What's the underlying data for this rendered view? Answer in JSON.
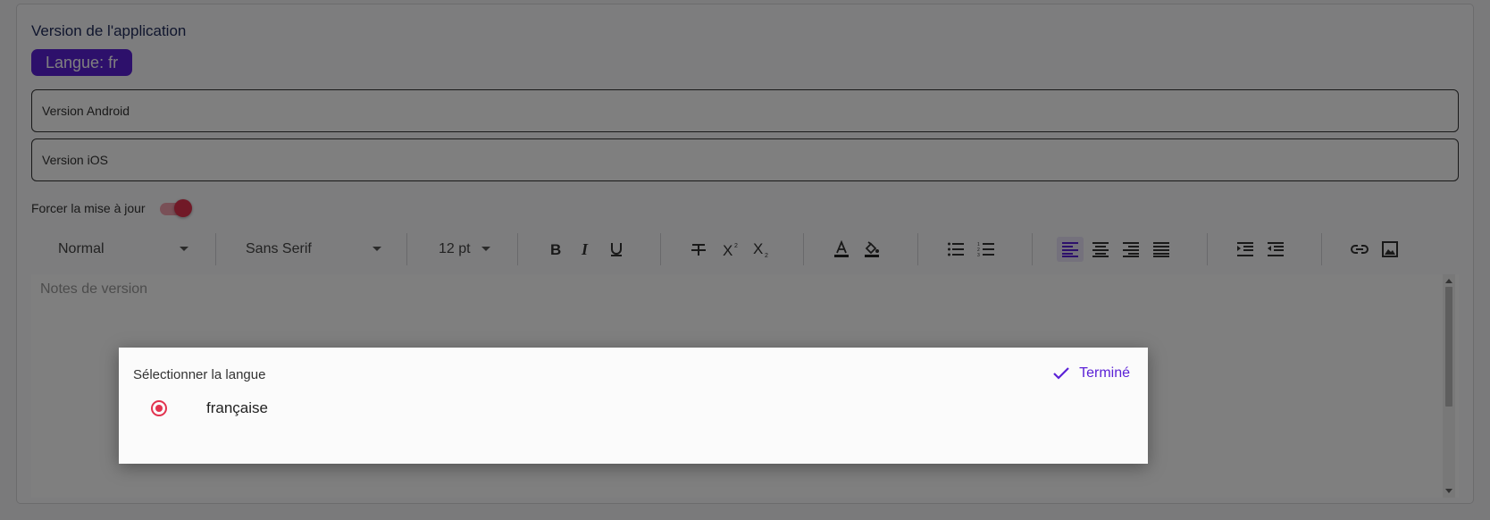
{
  "section": {
    "title": "Version de l'application",
    "language_chip": "Langue: fr"
  },
  "fields": {
    "android_label": "Version Android",
    "ios_label": "Version iOS"
  },
  "force_update": {
    "label": "Forcer la mise à jour",
    "enabled": true
  },
  "toolbar": {
    "heading_value": "Normal",
    "font_value": "Sans Serif",
    "size_value": "12 pt",
    "buttons": [
      "bold-icon",
      "italic-icon",
      "underline-icon",
      "strikethrough-icon",
      "superscript-icon",
      "subscript-icon",
      "text-color-icon",
      "highlight-color-icon",
      "bullet-list-icon",
      "numbered-list-icon",
      "align-left-icon",
      "align-center-icon",
      "align-right-icon",
      "align-justify-icon",
      "indent-icon",
      "outdent-icon",
      "link-icon",
      "image-icon"
    ],
    "active_button": "align-left-icon"
  },
  "editor": {
    "placeholder": "Notes de version"
  },
  "dialog": {
    "title": "Sélectionner la langue",
    "done_label": "Terminé",
    "options": [
      {
        "label": "française",
        "selected": true
      }
    ]
  },
  "colors": {
    "accent": "#5b21d6",
    "radio_toggle": "#e2334f"
  }
}
